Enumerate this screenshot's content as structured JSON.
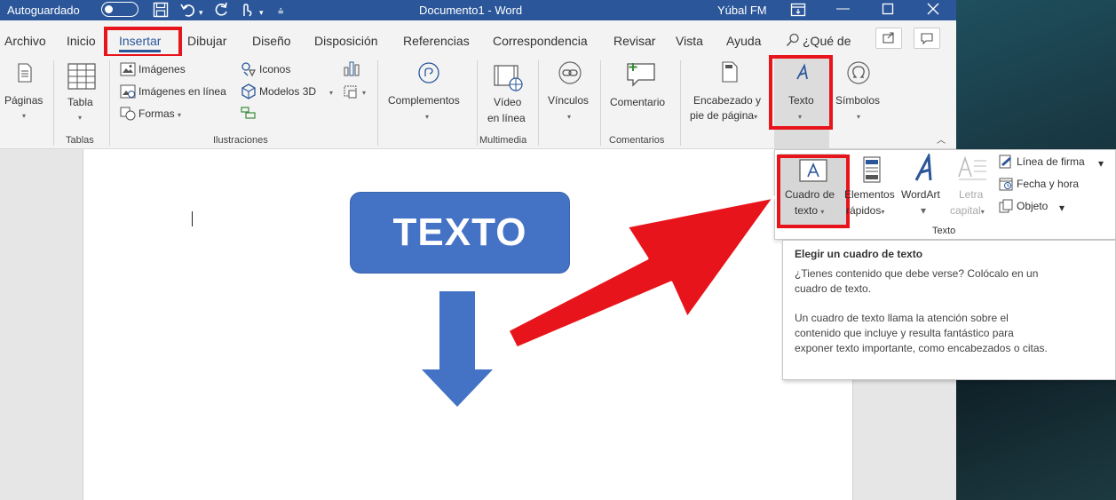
{
  "titlebar": {
    "autosave_label": "Autoguardado",
    "doc_title": "Documento1",
    "separator": "-",
    "app_name": "Word",
    "user_name": "Yúbal FM"
  },
  "menu": {
    "items": [
      "Archivo",
      "Inicio",
      "Insertar",
      "Dibujar",
      "Diseño",
      "Disposición",
      "Referencias",
      "Correspondencia",
      "Revisar",
      "Vista",
      "Ayuda"
    ],
    "search_label": "¿Qué de"
  },
  "ribbon": {
    "paginas": "Páginas",
    "tabla": "Tabla",
    "imagenes": "Imágenes",
    "imagenes_linea": "Imágenes en línea",
    "formas": "Formas",
    "iconos": "Iconos",
    "modelos3d": "Modelos 3D",
    "complementos": "Complementos",
    "video_1": "Vídeo",
    "video_2": "en línea",
    "vinculos": "Vínculos",
    "comentario": "Comentario",
    "encabezado_1": "Encabezado y",
    "encabezado_2": "pie de página",
    "texto": "Texto",
    "simbolos": "Símbolos",
    "groups": {
      "tablas": "Tablas",
      "ilustraciones": "Ilustraciones",
      "multimedia": "Multimedia",
      "comentarios": "Comentarios"
    }
  },
  "document": {
    "shape_text": "TEXTO"
  },
  "texto_panel": {
    "cuadro_1": "Cuadro de",
    "cuadro_2": "texto",
    "elementos_1": "Elementos",
    "elementos_2": "rápidos",
    "wordart": "WordArt",
    "letra_1": "Letra",
    "letra_2": "capital",
    "linea_firma": "Línea de firma",
    "fecha_hora": "Fecha y hora",
    "objeto": "Objeto",
    "group_label": "Texto"
  },
  "tooltip": {
    "title": "Elegir un cuadro de texto",
    "p1": "¿Tienes contenido que debe verse? Colócalo en un cuadro de texto.",
    "p2": "Un cuadro de texto llama la atención sobre el contenido que incluye y resulta fantástico para exponer texto importante, como encabezados o citas."
  },
  "colors": {
    "titlebar": "#2b579a",
    "highlight": "#e8141b",
    "shape_fill": "#4472c4"
  }
}
